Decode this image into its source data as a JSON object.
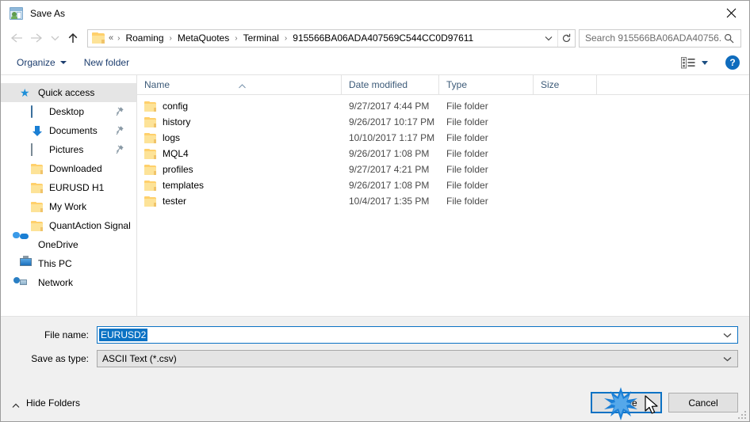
{
  "window": {
    "title": "Save As",
    "app_icon": "save-as-icon",
    "close_icon": "close-icon"
  },
  "nav": {
    "back_icon": "arrow-left-icon",
    "forward_icon": "arrow-right-icon",
    "recent_icon": "chevron-down-icon",
    "up_icon": "arrow-up-icon",
    "folder_icon": "folder-icon",
    "dropdown_icon": "chevron-down-icon",
    "refresh_icon": "refresh-icon",
    "breadcrumbs": [
      {
        "label": "«",
        "type": "overflow"
      },
      {
        "label": "Roaming",
        "type": "crumb"
      },
      {
        "label": "MetaQuotes",
        "type": "crumb"
      },
      {
        "label": "Terminal",
        "type": "crumb"
      },
      {
        "label": "915566BA06ADA407569C544CC0D97611",
        "type": "crumb"
      }
    ],
    "separator": "›"
  },
  "search": {
    "text": "Search 915566BA06ADA40756...",
    "icon": "search-icon"
  },
  "command_bar": {
    "organize_label": "Organize",
    "new_folder_label": "New folder",
    "view_icon": "view-layout-icon",
    "help_label": "?",
    "help_icon": "help-icon"
  },
  "sidebar": {
    "items": [
      {
        "label": "Quick access",
        "icon": "star-icon",
        "selected": true,
        "indent": false,
        "pinned": false
      },
      {
        "label": "Desktop",
        "icon": "desktop-icon",
        "selected": false,
        "indent": true,
        "pinned": true
      },
      {
        "label": "Documents",
        "icon": "documents-icon",
        "selected": false,
        "indent": true,
        "pinned": true
      },
      {
        "label": "Pictures",
        "icon": "pictures-icon",
        "selected": false,
        "indent": true,
        "pinned": true
      },
      {
        "label": "Downloaded",
        "icon": "folder-icon",
        "selected": false,
        "indent": true,
        "pinned": false
      },
      {
        "label": "EURUSD H1",
        "icon": "folder-icon",
        "selected": false,
        "indent": true,
        "pinned": false
      },
      {
        "label": "My Work",
        "icon": "folder-icon",
        "selected": false,
        "indent": true,
        "pinned": false
      },
      {
        "label": "QuantAction Signal",
        "icon": "folder-icon",
        "selected": false,
        "indent": true,
        "pinned": false
      },
      {
        "label": "OneDrive",
        "icon": "onedrive-icon",
        "selected": false,
        "indent": false,
        "pinned": false
      },
      {
        "label": "This PC",
        "icon": "this-pc-icon",
        "selected": false,
        "indent": false,
        "pinned": false
      },
      {
        "label": "Network",
        "icon": "network-icon",
        "selected": false,
        "indent": false,
        "pinned": false
      }
    ]
  },
  "file_list": {
    "columns": {
      "name": "Name",
      "date_modified": "Date modified",
      "type": "Type",
      "size": "Size"
    },
    "sort_column": "Name",
    "sort_direction": "ascending",
    "rows": [
      {
        "name": "config",
        "date": "9/27/2017 4:44 PM",
        "type": "File folder",
        "size": "",
        "icon": "folder-icon"
      },
      {
        "name": "history",
        "date": "9/26/2017 10:17 PM",
        "type": "File folder",
        "size": "",
        "icon": "folder-icon"
      },
      {
        "name": "logs",
        "date": "10/10/2017 1:17 PM",
        "type": "File folder",
        "size": "",
        "icon": "folder-icon"
      },
      {
        "name": "MQL4",
        "date": "9/26/2017 1:08 PM",
        "type": "File folder",
        "size": "",
        "icon": "folder-icon"
      },
      {
        "name": "profiles",
        "date": "9/27/2017 4:21 PM",
        "type": "File folder",
        "size": "",
        "icon": "folder-icon"
      },
      {
        "name": "templates",
        "date": "9/26/2017 1:08 PM",
        "type": "File folder",
        "size": "",
        "icon": "folder-icon"
      },
      {
        "name": "tester",
        "date": "10/4/2017 1:35 PM",
        "type": "File folder",
        "size": "",
        "icon": "folder-icon"
      }
    ]
  },
  "form": {
    "filename_label": "File name:",
    "filename_value": "EURUSD2",
    "filename_selected": true,
    "filetype_label": "Save as type:",
    "filetype_value": "ASCII Text (*.csv)",
    "dropdown_icon": "chevron-down-icon"
  },
  "footer": {
    "hide_folders_label": "Hide Folders",
    "hide_folders_icon": "chevron-up-icon",
    "save_label": "Save",
    "cancel_label": "Cancel",
    "resize_grip_icon": "resize-grip-icon"
  },
  "colors": {
    "accent": "#0b72c4",
    "selection": "#0b72c4",
    "sidebar_selection": "#e5e5e5",
    "folder_yellow": "#ffd06b",
    "header_text": "#3c5a78",
    "footer_bg": "#f0f0f0"
  },
  "cursor": {
    "icon": "mouse-pointer-icon",
    "click_effect": "click-burst-icon",
    "target": "Save"
  }
}
